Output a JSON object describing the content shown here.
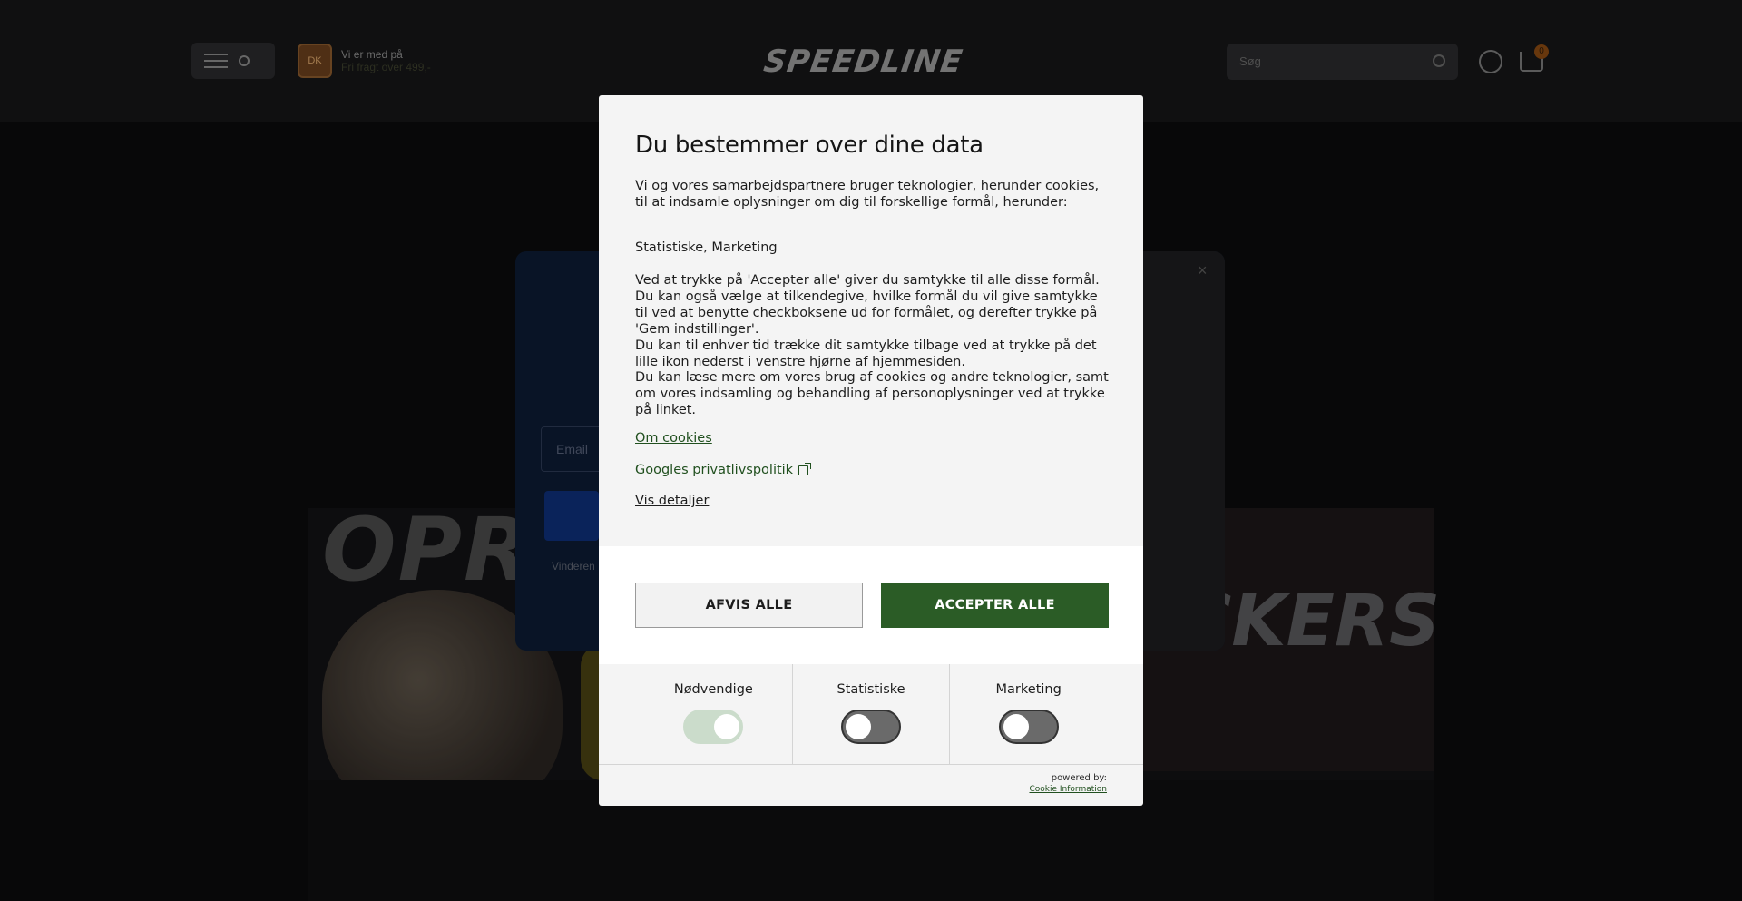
{
  "site": {
    "shipping_line1": "Vi er med på",
    "shipping_line2": "Fri fragt over 499,-",
    "shipping_badge": "DK",
    "logo": "SPEEDLINE",
    "search_placeholder": "Søg",
    "cart_count": "0",
    "banner_left": "OPRY",
    "banner_right": "CKERS",
    "promo_email_placeholder": "Email",
    "promo_small": "Vinderen",
    "promo_close": "×"
  },
  "dialog": {
    "title": "Du bestemmer over dine data",
    "p1": "Vi og vores samarbejdspartnere bruger teknologier, herunder cookies, til at indsamle oplysninger om dig til forskellige formål, herunder:",
    "p2": "Statistiske, Marketing",
    "p3": "Ved at trykke på 'Accepter alle' giver du samtykke til alle disse formål. Du kan også vælge at tilkendegive, hvilke formål du vil give samtykke til ved at benytte checkboksene ud for formålet, og derefter trykke på 'Gem indstillinger'.",
    "p3b": "Du kan til enhver tid trække dit samtykke tilbage ved at trykke på det lille ikon nederst i venstre hjørne af hjemmesiden.",
    "p4": "Du kan læse mere om vores brug af cookies og andre teknologier, samt om vores indsamling og behandling af personoplysninger ved at trykke på linket.",
    "link_cookies": "Om cookies",
    "link_google": "Googles privatlivspolitik",
    "link_details": "Vis detaljer",
    "btn_reject": "AFVIS ALLE",
    "btn_accept": "ACCEPTER ALLE",
    "toggles": [
      {
        "label": "Nødvendige",
        "on": true
      },
      {
        "label": "Statistiske",
        "on": false
      },
      {
        "label": "Marketing",
        "on": false
      }
    ],
    "powered_by": "powered by:",
    "powered_link": "Cookie Information"
  }
}
